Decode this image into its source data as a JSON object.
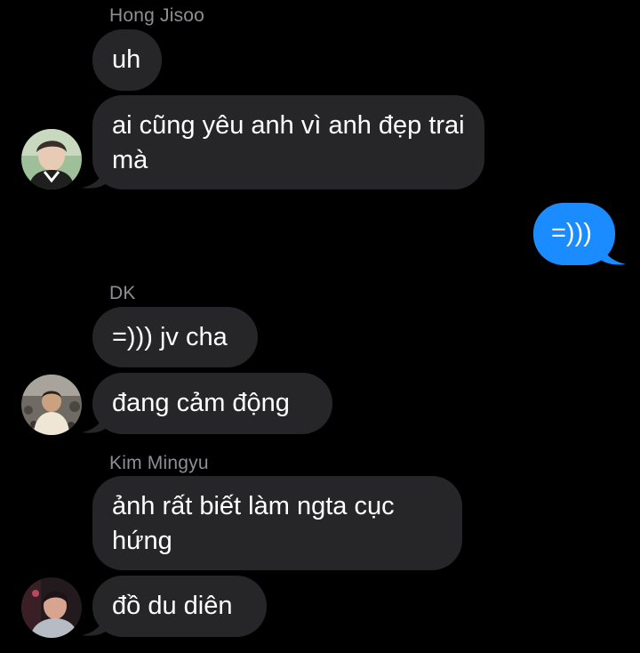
{
  "colors": {
    "background": "#000000",
    "incoming_bubble": "#262629",
    "outgoing_bubble": "#1a8cff",
    "sender_name": "#8e8e93",
    "text": "#ffffff"
  },
  "messages": [
    {
      "sender": "Hong Jisoo",
      "direction": "incoming",
      "text": "uh"
    },
    {
      "sender": "Hong Jisoo",
      "direction": "incoming",
      "text": "ai cũng yêu anh vì anh đẹp trai mà"
    },
    {
      "sender": "me",
      "direction": "outgoing",
      "text": "=)))"
    },
    {
      "sender": "DK",
      "direction": "incoming",
      "text": "=))) jv cha"
    },
    {
      "sender": "DK",
      "direction": "incoming",
      "text": "đang cảm động"
    },
    {
      "sender": "Kim Mingyu",
      "direction": "incoming",
      "text": "ảnh rất biết làm ngta cục hứng"
    },
    {
      "sender": "Kim Mingyu",
      "direction": "incoming",
      "text": "đồ du diên"
    }
  ],
  "avatars": [
    {
      "icon": "avatar-hong-jisoo"
    },
    {
      "icon": "avatar-dk"
    },
    {
      "icon": "avatar-kim-mingyu"
    }
  ]
}
